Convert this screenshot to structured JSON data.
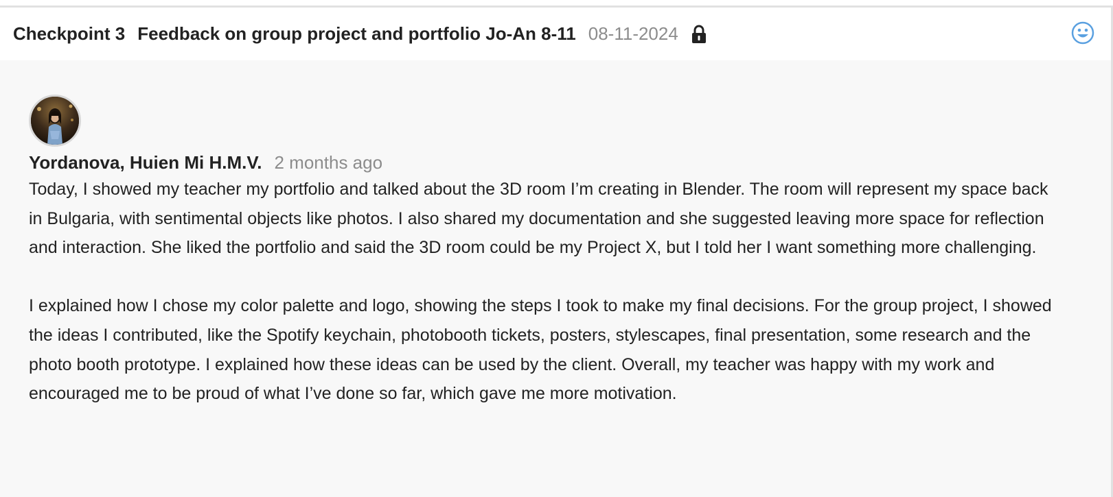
{
  "header": {
    "checkpoint": "Checkpoint 3",
    "title": "Feedback on group project and portfolio Jo-An 8-11",
    "date": "08-11-2024",
    "lock_icon": "lock-icon",
    "reaction_icon": "smiley-icon"
  },
  "comment": {
    "avatar_icon": "user-avatar",
    "author": "Yordanova, Huien Mi H.M.V.",
    "time_ago": "2 months ago",
    "paragraphs": [
      "Today, I showed my teacher my portfolio and talked about the 3D room I’m creating in Blender. The room will represent my space back in Bulgaria, with sentimental objects like photos. I also shared my documentation and she suggested leaving more space for reflection and interaction. She liked the portfolio and said the 3D room could be my Project X, but I told her I want something more challenging.",
      "I explained how I chose my color palette and logo, showing the steps I took to make my final decisions. For the group project, I showed the ideas I contributed, like the Spotify keychain, photobooth tickets, posters, stylescapes, final presentation, some research and the photo booth prototype. I explained how these ideas can be used by the client. Overall, my teacher was happy with my work and encouraged me to be proud of what I’ve done so far, which gave me more motivation."
    ]
  },
  "colors": {
    "accent_icon": "#5aa0e0",
    "muted_text": "#8c8c8c",
    "body_bg": "#f8f8f8",
    "header_bg": "#ffffff"
  }
}
